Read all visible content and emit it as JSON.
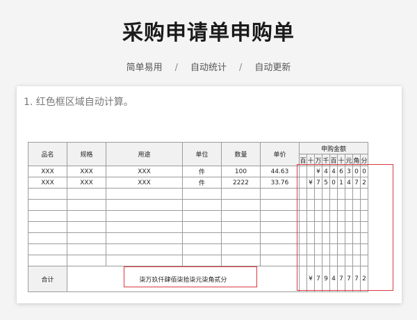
{
  "page": {
    "title": "采购申请单申购单",
    "tags": [
      "简单易用",
      "自动统计",
      "自动更新"
    ],
    "separator": "/"
  },
  "card": {
    "note": "1. 红色框区域自动计算。"
  },
  "table": {
    "headers": {
      "name": "品名",
      "spec": "规格",
      "purpose": "用途",
      "unit": "单位",
      "qty": "数量",
      "price": "单价",
      "amount": "申购金额"
    },
    "digit_headers": [
      "百",
      "十",
      "万",
      "千",
      "百",
      "十",
      "元",
      "角",
      "分"
    ],
    "rows": [
      {
        "name": "XXX",
        "spec": "XXX",
        "purpose": "XXX",
        "unit": "件",
        "qty": "100",
        "price": "44.63",
        "digits": [
          "",
          "",
          "¥",
          "4",
          "4",
          "6",
          "3",
          "0",
          "0"
        ]
      },
      {
        "name": "XXX",
        "spec": "XXX",
        "purpose": "XXX",
        "unit": "件",
        "qty": "2222",
        "price": "33.76",
        "digits": [
          "",
          "¥",
          "7",
          "5",
          "0",
          "1",
          "4",
          "7",
          "2"
        ]
      }
    ],
    "empty_rows": 7,
    "total": {
      "label": "合计",
      "uppercase": "柒万玖仟肆佰柒拾柒元柒角贰分",
      "digits": [
        "",
        "¥",
        "7",
        "9",
        "4",
        "7",
        "7",
        "7",
        "2"
      ]
    }
  },
  "colors": {
    "highlight": "#d9363e",
    "border": "#9a9a9a"
  }
}
